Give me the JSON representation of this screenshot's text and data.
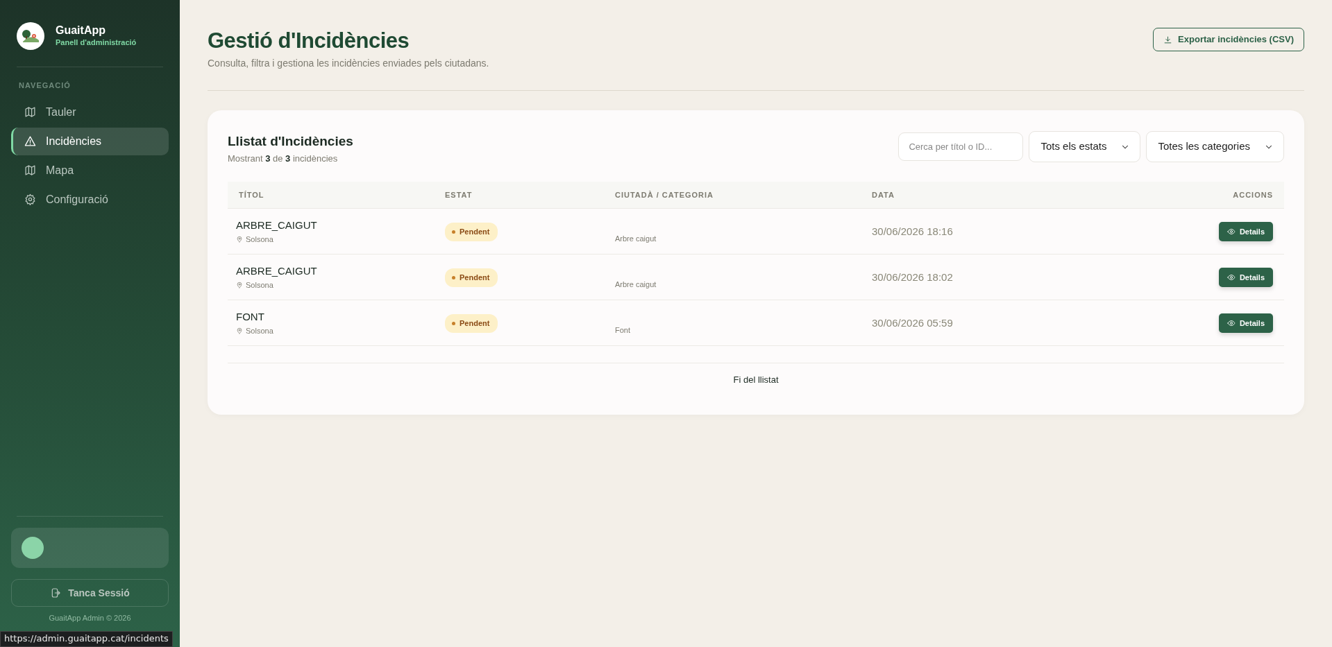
{
  "sidebar": {
    "brand": "GuaitApp",
    "subtitle": "Panell d'administració",
    "section_label": "NAVEGACIÓ",
    "items": [
      {
        "label": "Tauler",
        "selected": false
      },
      {
        "label": "Incidències",
        "selected": true
      },
      {
        "label": "Mapa",
        "selected": false
      },
      {
        "label": "Configuració",
        "selected": false
      }
    ],
    "logout": "Tanca Sessió",
    "footer": "GuaitApp Admin © 2026"
  },
  "header": {
    "title": "Gestió d'Incidències",
    "subtitle": "Consulta, filtra i gestiona les incidències enviades pels ciutadans.",
    "export_button": "Exportar incidències (CSV)"
  },
  "list": {
    "title": "Llistat d'Incidències",
    "summary": "Mostrant **3** de **3** incidències",
    "search": {
      "placeholder": "Cerca per títol o ID..."
    },
    "filters": [
      "Tots els estats",
      "Totes les categories"
    ],
    "table": {
      "columns": [
        "TÍTOL",
        "ESTAT",
        "CIUTADÀ / CATEGORIA",
        "DATA",
        "ACCIONS"
      ],
      "rows": [
        {
          "title": "ARBRE_CAIGUT",
          "location": "Solsona",
          "status": "Pendent",
          "category": "Arbre caigut",
          "date": "30/06/2026 18:16",
          "action": "Details"
        },
        {
          "title": "ARBRE_CAIGUT",
          "location": "Solsona",
          "status": "Pendent",
          "category": "Arbre caigut",
          "date": "30/06/2026 18:02",
          "action": "Details"
        },
        {
          "title": "FONT",
          "location": "Solsona",
          "status": "Pendent",
          "category": "Font",
          "date": "30/06/2026 05:59",
          "action": "Details"
        }
      ]
    },
    "end_text": "Fi del llistat"
  },
  "status_url": "https://admin.guaitapp.cat/incidents"
}
